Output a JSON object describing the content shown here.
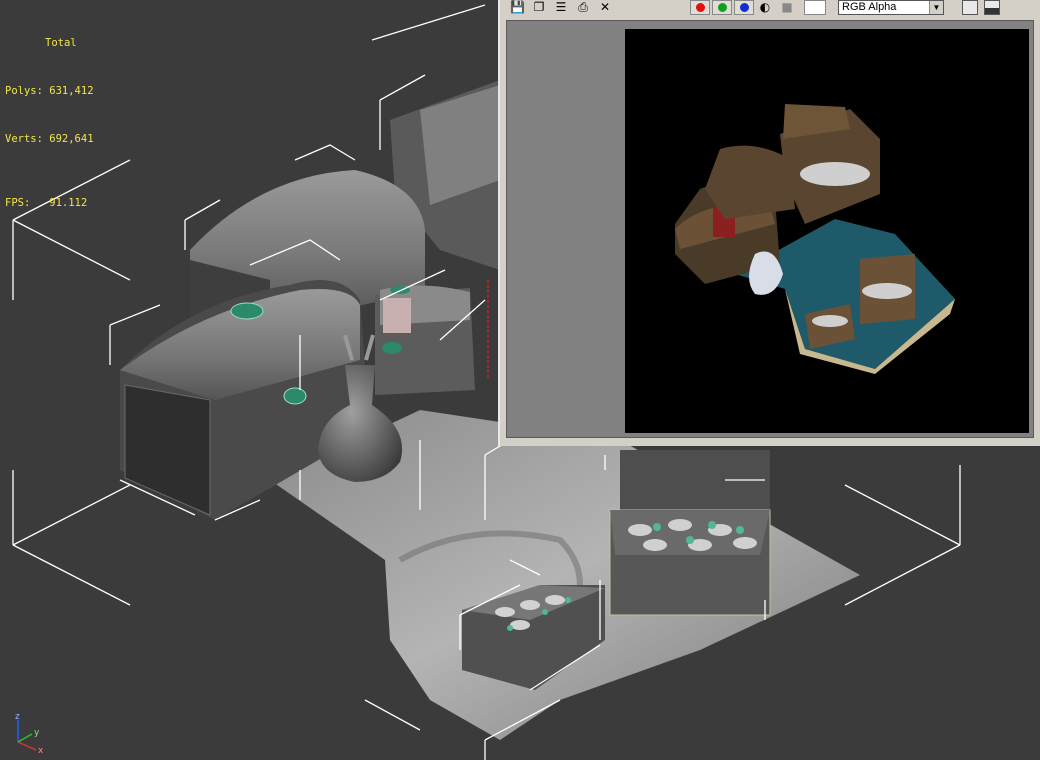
{
  "viewport": {
    "stats": {
      "title": "Total",
      "polys_label": "Polys:",
      "polys_value": "631,412",
      "verts_label": "Verts:",
      "verts_value": "692,641",
      "fps_label": "FPS:",
      "fps_value": "91.112"
    },
    "axis": {
      "x": "x",
      "y": "y",
      "z": "z"
    }
  },
  "frame_window": {
    "toolbar": {
      "icons": [
        "save-icon",
        "clone-icon",
        "track-icon",
        "print-icon",
        "clear-icon"
      ],
      "channel_buttons": [
        {
          "name": "red-channel",
          "color": "#e01010"
        },
        {
          "name": "green-channel",
          "color": "#10a020"
        },
        {
          "name": "blue-channel",
          "color": "#1030d0"
        }
      ],
      "channel_display": "RGB Alpha"
    }
  }
}
